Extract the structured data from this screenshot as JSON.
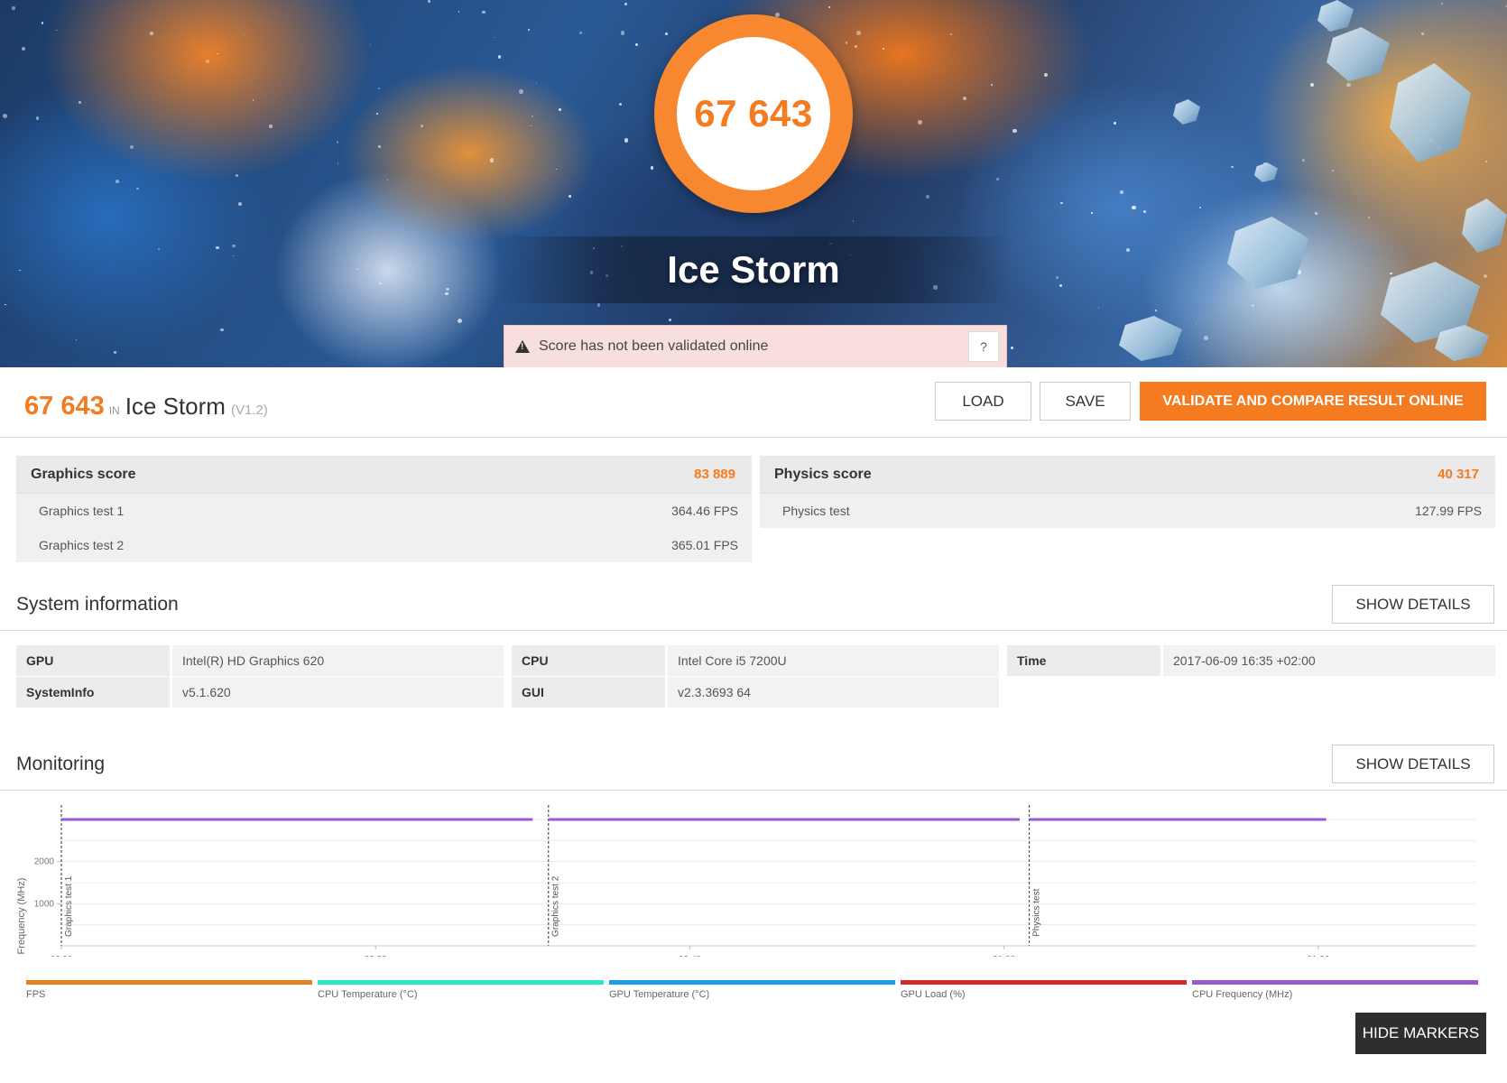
{
  "hero": {
    "score": "67 643",
    "title": "Ice Storm",
    "warning": "Score has not been validated online",
    "help_label": "?"
  },
  "result": {
    "score": "67 643",
    "in_label": "IN",
    "test_name": "Ice Storm",
    "version": "(V1.2)",
    "load_label": "LOAD",
    "save_label": "SAVE",
    "validate_label": "VALIDATE AND COMPARE RESULT ONLINE"
  },
  "graphics": {
    "label": "Graphics score",
    "value": "83 889",
    "tests": [
      {
        "name": "Graphics test 1",
        "value": "364.46 FPS"
      },
      {
        "name": "Graphics test 2",
        "value": "365.01 FPS"
      }
    ]
  },
  "physics": {
    "label": "Physics score",
    "value": "40 317",
    "tests": [
      {
        "name": "Physics test",
        "value": "127.99 FPS"
      }
    ]
  },
  "system": {
    "title": "System information",
    "show_details": "SHOW DETAILS",
    "rows": [
      {
        "key": "GPU",
        "value": "Intel(R) HD Graphics 620"
      },
      {
        "key": "CPU",
        "value": "Intel Core i5 7200U"
      },
      {
        "key": "Time",
        "value": "2017-06-09 16:35 +02:00"
      },
      {
        "key": "SystemInfo",
        "value": "v5.1.620"
      },
      {
        "key": "GUI",
        "value": "v2.3.3693 64"
      }
    ]
  },
  "monitoring": {
    "title": "Monitoring",
    "show_details": "SHOW DETAILS",
    "hide_markers": "HIDE MARKERS"
  },
  "chart_data": {
    "type": "line",
    "ylabel": "Frequency (MHz)",
    "xlabel": "",
    "x_ticks": [
      "00:00",
      "00:20",
      "00:40",
      "01:00",
      "01:20"
    ],
    "y_ticks": [
      "1000",
      "2000"
    ],
    "xlim": [
      0,
      90
    ],
    "ylim": [
      0,
      3000
    ],
    "grid": true,
    "markers": [
      {
        "label": "Graphics test 1",
        "x": 0
      },
      {
        "label": "Graphics test 2",
        "x": 31
      },
      {
        "label": "Physics test",
        "x": 61.6
      }
    ],
    "series": [
      {
        "name": "CPU Frequency (MHz)",
        "color": "#9b59d0",
        "segments": [
          [
            0,
            30
          ],
          [
            31,
            61
          ],
          [
            61.6,
            80.5
          ]
        ],
        "value": 3000
      }
    ],
    "legend": [
      {
        "name": "FPS",
        "color": "#e67e22"
      },
      {
        "name": "CPU Temperature (°C)",
        "color": "#2ee6c0"
      },
      {
        "name": "GPU Temperature (°C)",
        "color": "#1e9be6"
      },
      {
        "name": "GPU Load (%)",
        "color": "#cf2a2a"
      },
      {
        "name": "CPU Frequency (MHz)",
        "color": "#9b59d0"
      }
    ]
  },
  "colors": {
    "accent": "#f47b20",
    "dark_button": "#2e2e2e",
    "warning_bg": "#f9dede"
  }
}
